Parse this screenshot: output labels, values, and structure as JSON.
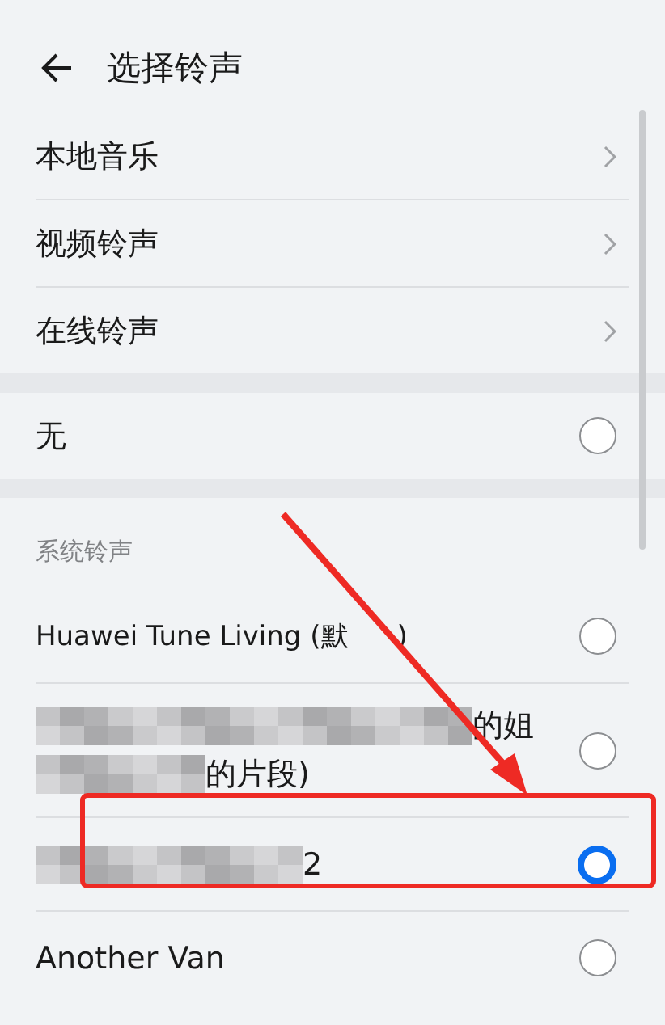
{
  "header": {
    "title": "选择铃声"
  },
  "links": [
    {
      "label": "本地音乐"
    },
    {
      "label": "视频铃声"
    },
    {
      "label": "在线铃声"
    }
  ],
  "none_option": {
    "label": "无",
    "selected": false
  },
  "section": {
    "title": "系统铃声"
  },
  "ringtones": [
    {
      "kind": "covered",
      "lines": [
        "Huawei Tune Living (默",
        ")"
      ],
      "selected": false
    },
    {
      "kind": "masked2",
      "lines": [
        "的姐",
        "的片段)"
      ],
      "selected": false
    },
    {
      "kind": "masked1",
      "lines": [
        "2"
      ],
      "selected": true
    },
    {
      "kind": "plain",
      "label": "Another Van",
      "selected": false
    }
  ]
}
